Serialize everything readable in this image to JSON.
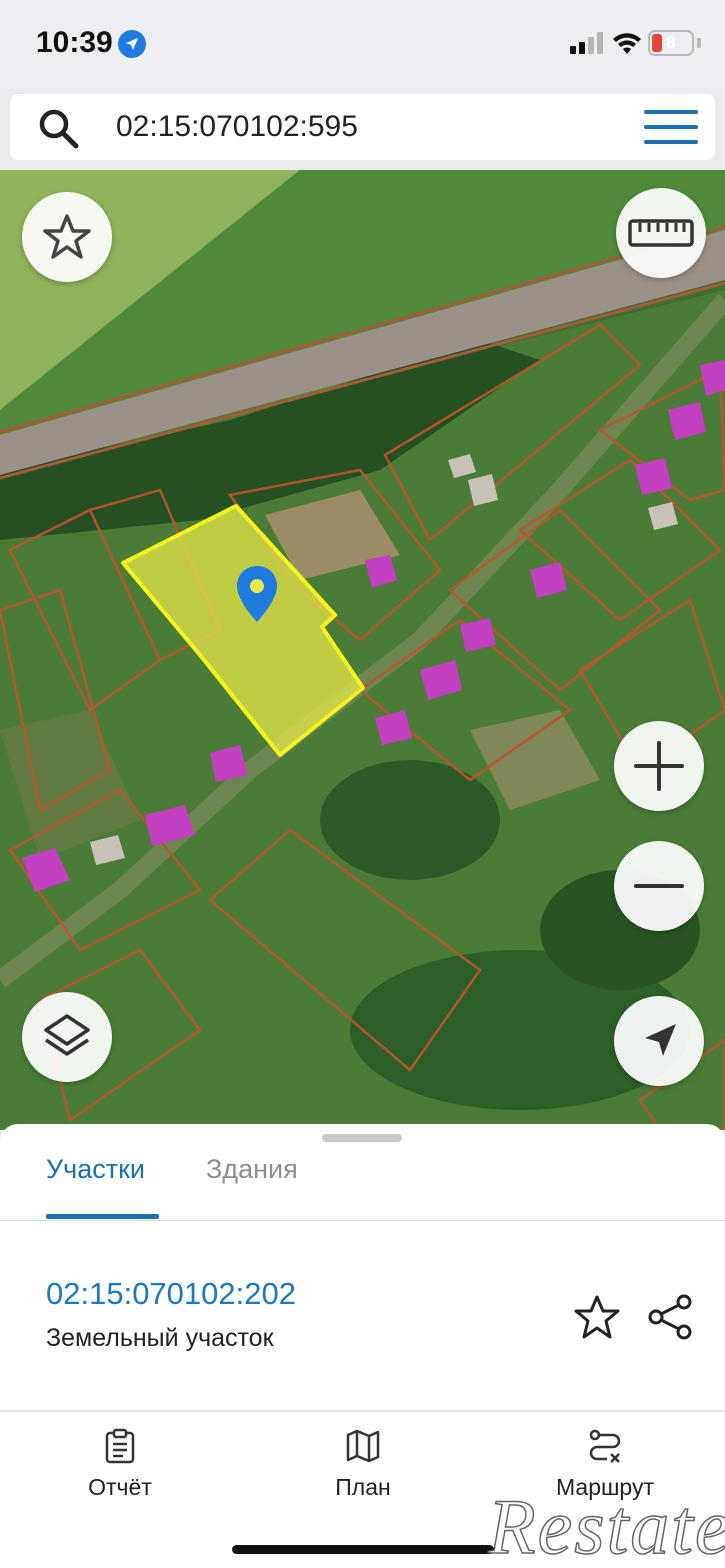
{
  "status_bar": {
    "time": "10:39",
    "battery_level": "8",
    "location_icon": "location-arrow-icon",
    "signal_icon": "cellular-signal-icon",
    "wifi_icon": "wifi-icon"
  },
  "search": {
    "value": "02:15:070102:595",
    "icon": "search-icon",
    "menu_icon": "hamburger-menu-icon"
  },
  "map": {
    "selected_parcel_color": "#e7e84a",
    "parcel_border_color": "#c0522f",
    "marker_color": "#1f7ae0",
    "controls": [
      "star-icon",
      "ruler-icon",
      "plus-icon",
      "minus-icon",
      "layers-icon",
      "locate-arrow-icon"
    ]
  },
  "sheet": {
    "tabs": [
      {
        "label": "Участки",
        "active": true
      },
      {
        "label": "Здания",
        "active": false
      }
    ],
    "result": {
      "number": "02:15:070102:202",
      "type": "Земельный участок"
    },
    "accent": "#1b6fb5"
  },
  "nav": {
    "items": [
      {
        "label": "Отчёт",
        "icon": "clipboard-report-icon"
      },
      {
        "label": "План",
        "icon": "map-plan-icon"
      },
      {
        "label": "Маршрут",
        "icon": "route-icon"
      }
    ]
  },
  "watermark": "Restate"
}
